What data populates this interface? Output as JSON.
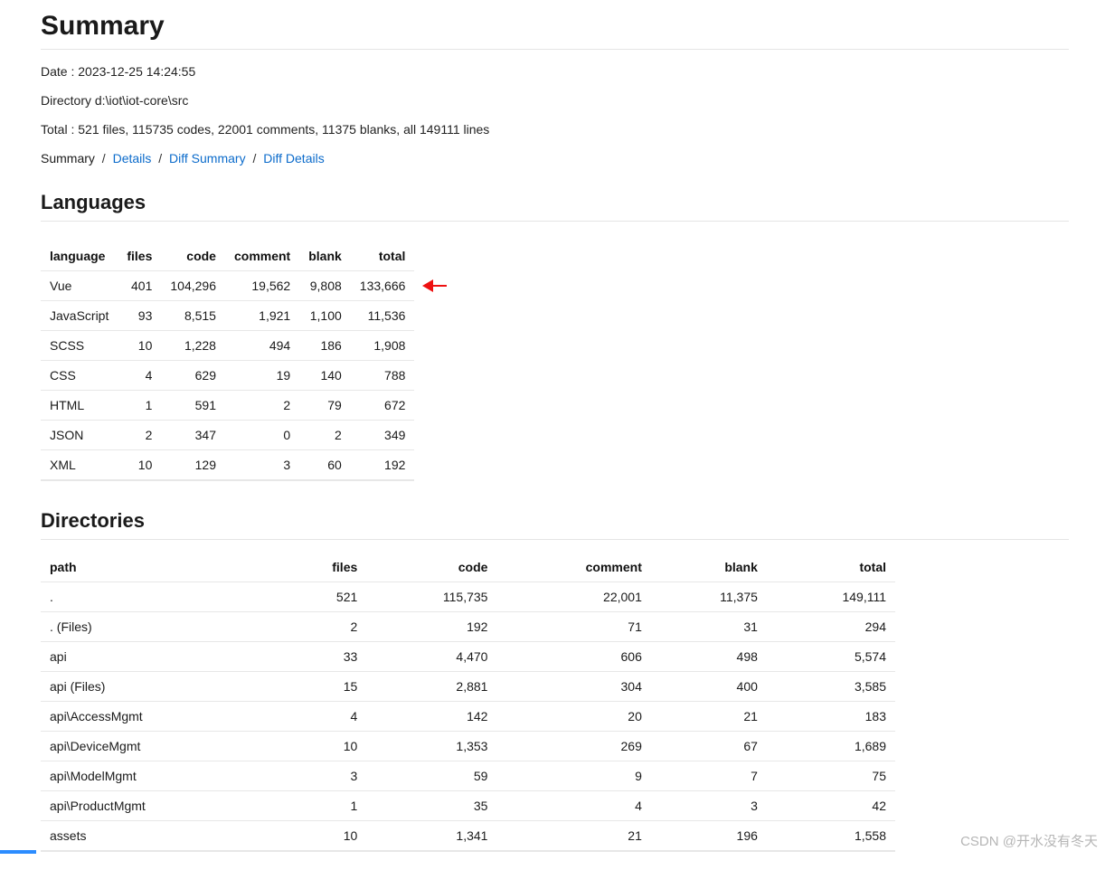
{
  "title": "Summary",
  "meta": {
    "date_line": "Date : 2023-12-25 14:24:55",
    "directory_line": "Directory d:\\iot\\iot-core\\src",
    "total_line": "Total : 521 files, 115735 codes, 22001 comments, 11375 blanks, all 149111 lines"
  },
  "breadcrumb": {
    "current": "Summary",
    "sep": " / ",
    "links": [
      "Details",
      "Diff Summary",
      "Diff Details"
    ]
  },
  "languages": {
    "heading": "Languages",
    "headers": [
      "language",
      "files",
      "code",
      "comment",
      "blank",
      "total"
    ],
    "rows": [
      [
        "Vue",
        "401",
        "104,296",
        "19,562",
        "9,808",
        "133,666"
      ],
      [
        "JavaScript",
        "93",
        "8,515",
        "1,921",
        "1,100",
        "11,536"
      ],
      [
        "SCSS",
        "10",
        "1,228",
        "494",
        "186",
        "1,908"
      ],
      [
        "CSS",
        "4",
        "629",
        "19",
        "140",
        "788"
      ],
      [
        "HTML",
        "1",
        "591",
        "2",
        "79",
        "672"
      ],
      [
        "JSON",
        "2",
        "347",
        "0",
        "2",
        "349"
      ],
      [
        "XML",
        "10",
        "129",
        "3",
        "60",
        "192"
      ]
    ]
  },
  "directories": {
    "heading": "Directories",
    "headers": [
      "path",
      "files",
      "code",
      "comment",
      "blank",
      "total"
    ],
    "rows": [
      [
        ".",
        "521",
        "115,735",
        "22,001",
        "11,375",
        "149,111"
      ],
      [
        ". (Files)",
        "2",
        "192",
        "71",
        "31",
        "294"
      ],
      [
        "api",
        "33",
        "4,470",
        "606",
        "498",
        "5,574"
      ],
      [
        "api (Files)",
        "15",
        "2,881",
        "304",
        "400",
        "3,585"
      ],
      [
        "api\\AccessMgmt",
        "4",
        "142",
        "20",
        "21",
        "183"
      ],
      [
        "api\\DeviceMgmt",
        "10",
        "1,353",
        "269",
        "67",
        "1,689"
      ],
      [
        "api\\ModelMgmt",
        "3",
        "59",
        "9",
        "7",
        "75"
      ],
      [
        "api\\ProductMgmt",
        "1",
        "35",
        "4",
        "3",
        "42"
      ],
      [
        "assets",
        "10",
        "1,341",
        "21",
        "196",
        "1,558"
      ]
    ]
  },
  "watermark": "CSDN @开水没有冬天"
}
